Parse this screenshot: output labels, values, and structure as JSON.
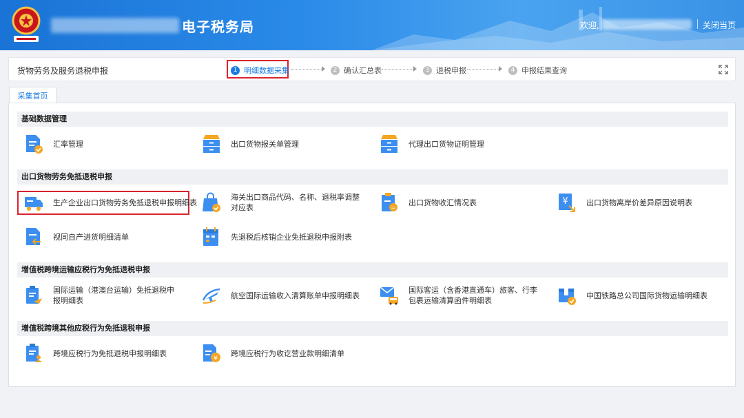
{
  "header": {
    "bureau_title": "电子税务局",
    "welcome": "欢迎,",
    "close_page": "关闭当页"
  },
  "stepbar": {
    "page_title": "货物劳务及服务退税申报",
    "steps": [
      {
        "num": "1",
        "label": "明细数据采集"
      },
      {
        "num": "2",
        "label": "确认汇总表"
      },
      {
        "num": "3",
        "label": "退税申报"
      },
      {
        "num": "4",
        "label": "申报结果查询"
      }
    ]
  },
  "tab": {
    "label": "采集首页"
  },
  "sections": [
    {
      "title": "基础数据管理",
      "items": [
        {
          "label": "汇率管理",
          "icon": "doc-check-icon"
        },
        {
          "label": "出口货物报关单管理",
          "icon": "drawer-cabinet-icon"
        },
        {
          "label": "代理出口货物证明管理",
          "icon": "drawer-cabinet-icon"
        }
      ]
    },
    {
      "title": "出口货物劳务免抵退税申报",
      "items": [
        {
          "label": "生产企业出口货物劳务免抵退税申报明细表",
          "icon": "truck-icon"
        },
        {
          "label": "海关出口商品代码、名称、退税率调整对应表",
          "icon": "shopping-bag-icon"
        },
        {
          "label": "出口货物收汇情况表",
          "icon": "clipboard-money-icon"
        },
        {
          "label": "出口货物离岸价差异原因说明表",
          "icon": "yen-doc-icon"
        },
        {
          "label": "视同自产进货明细清单",
          "icon": "doc-arrow-icon"
        },
        {
          "label": "先退税后核销企业免抵退税申报附表",
          "icon": "calendar-doc-icon"
        }
      ]
    },
    {
      "title": "增值税跨境运输应税行为免抵退税申报",
      "items": [
        {
          "label": "国际运输（港澳台运输）免抵退税申报明细表",
          "icon": "clipboard-plane-icon"
        },
        {
          "label": "航空国际运输收入清算账单申报明细表",
          "icon": "airplane-icon"
        },
        {
          "label": "国际客运（含香港直通车）旅客、行李包裹运输清算函件明细表",
          "icon": "mail-bus-icon"
        },
        {
          "label": "中国铁路总公司国际货物运输明细表",
          "icon": "box-check-icon"
        }
      ]
    },
    {
      "title": "增值税跨境其他应税行为免抵退税申报",
      "items": [
        {
          "label": "跨境应税行为免抵退税申报明细表",
          "icon": "clipboard-person-icon"
        },
        {
          "label": "跨境应税行为收讫营业款明细清单",
          "icon": "doc-yen-icon"
        }
      ]
    }
  ],
  "colors": {
    "primary": "#1a7ce0",
    "icon_blue": "#3c8ff0",
    "icon_orange": "#f5a623",
    "highlight_red": "#d9232d"
  }
}
